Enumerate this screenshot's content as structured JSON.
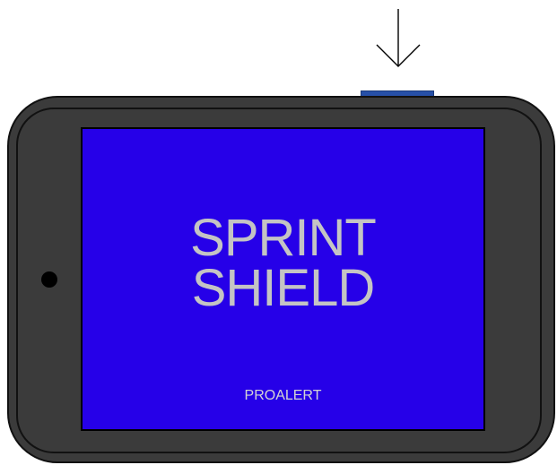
{
  "screen": {
    "title_line1": "SPRINT",
    "title_line2": "SHIELD",
    "brand": "PROALERT"
  },
  "icons": {
    "pointer": "down-arrow-icon",
    "camera": "camera-dot-icon"
  },
  "colors": {
    "device_body": "#3b3b3b",
    "screen_background": "#2600e8",
    "title_text": "#c4c4c4",
    "side_button": "#2750a8"
  }
}
